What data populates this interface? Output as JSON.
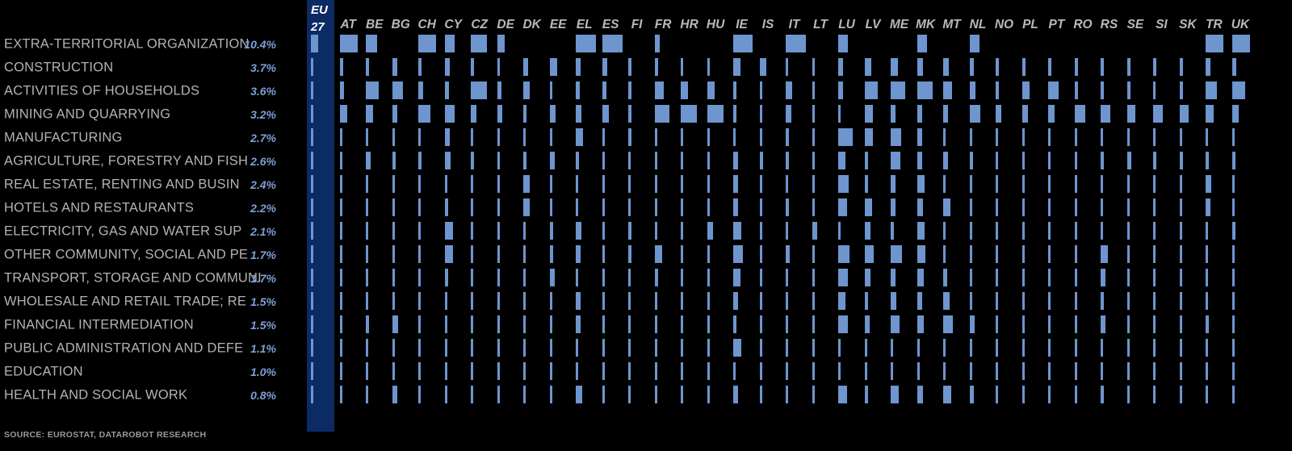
{
  "meta": {
    "eu_header_line1": "EU",
    "eu_header_line2": "27",
    "source": "SOURCE: EUROSTAT, DATAROBOT RESEARCH",
    "bar_color": "#6e95ce",
    "panel_color": "#0c2a63",
    "background_color": "#000000",
    "label_color": "#b3b3b3",
    "value_color": "#7e9fd4"
  },
  "chart_data": {
    "type": "heatmap",
    "title": "",
    "subtitle": "",
    "xlabel": "",
    "ylabel": "",
    "grid": false,
    "legend": "none",
    "notes": "Bar-matrix: each cell holds a left-aligned horizontal bar whose width encodes the sector's share per country. The first column (EU 27) is highlighted on a navy panel and is labelled with the printed percentage.",
    "categories": [
      "EXTRA-TERRITORIAL ORGANIZATION",
      "CONSTRUCTION",
      "ACTIVITIES OF HOUSEHOLDS",
      "MINING AND QUARRYING",
      "MANUFACTURING",
      "AGRICULTURE, FORESTRY AND FISH",
      "REAL ESTATE, RENTING AND BUSIN",
      "HOTELS AND RESTAURANTS",
      "ELECTRICITY, GAS AND WATER SUP",
      "OTHER COMMUNITY, SOCIAL AND PE",
      "TRANSPORT, STORAGE AND COMMUNI",
      "WHOLESALE AND RETAIL TRADE; RE",
      "FINANCIAL INTERMEDIATION",
      "PUBLIC ADMINISTRATION AND DEFE",
      "EDUCATION",
      "HEALTH AND SOCIAL WORK"
    ],
    "eu27_values": [
      "10.4%",
      "3.7%",
      "3.6%",
      "3.2%",
      "2.7%",
      "2.6%",
      "2.4%",
      "2.2%",
      "2.1%",
      "1.7%",
      "1.7%",
      "1.5%",
      "1.5%",
      "1.1%",
      "1.0%",
      "0.8%"
    ],
    "eu27_numeric": [
      10.4,
      3.7,
      3.6,
      3.2,
      2.7,
      2.6,
      2.4,
      2.2,
      2.1,
      1.7,
      1.7,
      1.5,
      1.5,
      1.1,
      1.0,
      0.8
    ],
    "countries": [
      "AT",
      "BE",
      "BG",
      "CH",
      "CY",
      "CZ",
      "DE",
      "DK",
      "EE",
      "EL",
      "ES",
      "FI",
      "FR",
      "HR",
      "HU",
      "IE",
      "IS",
      "IT",
      "LT",
      "LU",
      "LV",
      "ME",
      "MK",
      "MT",
      "NL",
      "NO",
      "PL",
      "PT",
      "RO",
      "RS",
      "SE",
      "SI",
      "SK",
      "TR",
      "UK"
    ],
    "series": [
      {
        "name": "EXTRA-TERRITORIAL ORGANIZATION",
        "values": [
          22,
          14,
          0,
          22,
          12,
          20,
          9,
          0,
          0,
          25,
          25,
          0,
          6,
          0,
          0,
          24,
          0,
          25,
          0,
          12,
          0,
          0,
          12,
          0,
          12,
          0,
          0,
          0,
          0,
          0,
          0,
          0,
          0,
          22,
          22
        ]
      },
      {
        "name": "CONSTRUCTION",
        "values": [
          4,
          4,
          6,
          4,
          6,
          4,
          3,
          6,
          9,
          6,
          6,
          4,
          4,
          3,
          3,
          9,
          8,
          3,
          3,
          6,
          8,
          9,
          7,
          7,
          5,
          4,
          4,
          4,
          4,
          4,
          4,
          4,
          4,
          6,
          5
        ]
      },
      {
        "name": "ACTIVITIES OF HOUSEHOLDS",
        "values": [
          5,
          16,
          13,
          6,
          5,
          20,
          5,
          8,
          3,
          5,
          5,
          4,
          11,
          9,
          9,
          4,
          3,
          8,
          3,
          6,
          16,
          18,
          19,
          11,
          7,
          4,
          9,
          13,
          4,
          4,
          4,
          3,
          4,
          14,
          16
        ]
      },
      {
        "name": "MINING AND QUARRYING",
        "values": [
          9,
          9,
          6,
          15,
          12,
          7,
          6,
          4,
          7,
          7,
          8,
          4,
          18,
          20,
          20,
          4,
          3,
          7,
          3,
          3,
          10,
          6,
          6,
          6,
          13,
          7,
          7,
          8,
          13,
          12,
          10,
          12,
          11,
          10,
          8
        ]
      },
      {
        "name": "MANUFACTURING",
        "values": [
          3,
          3,
          3,
          3,
          6,
          3,
          3,
          3,
          3,
          9,
          3,
          4,
          3,
          3,
          3,
          3,
          3,
          4,
          3,
          18,
          10,
          13,
          6,
          3,
          3,
          3,
          3,
          3,
          3,
          3,
          3,
          3,
          3,
          3,
          3
        ]
      },
      {
        "name": "AGRICULTURE, FORESTRY AND FISH",
        "values": [
          3,
          6,
          4,
          4,
          7,
          4,
          3,
          4,
          6,
          4,
          3,
          3,
          3,
          3,
          3,
          6,
          4,
          4,
          3,
          9,
          4,
          12,
          6,
          6,
          4,
          3,
          3,
          3,
          3,
          4,
          5,
          4,
          4,
          4,
          4
        ]
      },
      {
        "name": "REAL ESTATE, RENTING AND BUSIN",
        "values": [
          3,
          3,
          3,
          3,
          3,
          3,
          3,
          8,
          3,
          3,
          3,
          3,
          3,
          3,
          3,
          6,
          3,
          3,
          3,
          13,
          4,
          6,
          9,
          3,
          3,
          3,
          3,
          3,
          3,
          3,
          3,
          3,
          3,
          7,
          3
        ]
      },
      {
        "name": "HOTELS AND RESTAURANTS",
        "values": [
          3,
          3,
          3,
          3,
          4,
          3,
          3,
          8,
          3,
          3,
          3,
          3,
          3,
          3,
          3,
          6,
          3,
          4,
          3,
          11,
          9,
          6,
          7,
          9,
          3,
          3,
          3,
          3,
          3,
          3,
          3,
          3,
          3,
          6,
          3
        ]
      },
      {
        "name": "ELECTRICITY, GAS AND WATER SUP",
        "values": [
          3,
          3,
          3,
          3,
          10,
          3,
          3,
          3,
          4,
          7,
          3,
          4,
          3,
          3,
          7,
          10,
          3,
          3,
          6,
          3,
          7,
          4,
          9,
          3,
          3,
          3,
          3,
          3,
          3,
          3,
          3,
          3,
          3,
          3,
          4
        ]
      },
      {
        "name": "OTHER COMMUNITY, SOCIAL AND PE",
        "values": [
          3,
          3,
          3,
          3,
          10,
          3,
          3,
          3,
          4,
          6,
          3,
          4,
          9,
          3,
          3,
          12,
          3,
          5,
          3,
          14,
          11,
          14,
          10,
          3,
          3,
          3,
          3,
          3,
          3,
          9,
          3,
          3,
          3,
          3,
          3
        ]
      },
      {
        "name": "TRANSPORT, STORAGE AND COMMUNI",
        "values": [
          3,
          3,
          3,
          3,
          4,
          3,
          3,
          3,
          6,
          3,
          3,
          3,
          4,
          3,
          3,
          9,
          3,
          3,
          3,
          12,
          7,
          6,
          8,
          5,
          3,
          3,
          3,
          3,
          3,
          6,
          3,
          3,
          3,
          3,
          3
        ]
      },
      {
        "name": "WHOLESALE AND RETAIL TRADE; RE",
        "values": [
          3,
          3,
          3,
          3,
          3,
          3,
          3,
          3,
          3,
          6,
          3,
          3,
          3,
          3,
          3,
          6,
          3,
          3,
          3,
          9,
          4,
          7,
          6,
          8,
          3,
          3,
          3,
          3,
          3,
          4,
          3,
          3,
          3,
          3,
          3
        ]
      },
      {
        "name": "FINANCIAL INTERMEDIATION",
        "values": [
          3,
          4,
          7,
          3,
          3,
          3,
          3,
          3,
          3,
          6,
          3,
          3,
          3,
          3,
          3,
          4,
          3,
          3,
          3,
          12,
          6,
          11,
          8,
          12,
          6,
          3,
          3,
          3,
          3,
          6,
          3,
          3,
          3,
          4,
          3
        ]
      },
      {
        "name": "PUBLIC ADMINISTRATION AND DEFE",
        "values": [
          3,
          3,
          3,
          3,
          3,
          3,
          3,
          3,
          3,
          3,
          3,
          3,
          3,
          3,
          3,
          10,
          3,
          3,
          3,
          3,
          3,
          3,
          3,
          3,
          3,
          3,
          3,
          3,
          3,
          3,
          3,
          3,
          3,
          3,
          3
        ]
      },
      {
        "name": "EDUCATION",
        "values": [
          3,
          3,
          3,
          3,
          3,
          3,
          3,
          3,
          3,
          3,
          3,
          3,
          3,
          3,
          3,
          3,
          3,
          3,
          3,
          3,
          3,
          3,
          3,
          3,
          3,
          3,
          3,
          3,
          3,
          3,
          3,
          3,
          3,
          3,
          3
        ]
      },
      {
        "name": "HEALTH AND SOCIAL WORK",
        "values": [
          3,
          3,
          6,
          3,
          3,
          3,
          3,
          3,
          3,
          8,
          3,
          3,
          3,
          3,
          3,
          6,
          3,
          3,
          3,
          11,
          4,
          10,
          7,
          10,
          5,
          3,
          3,
          3,
          3,
          4,
          3,
          3,
          3,
          3,
          3
        ]
      }
    ],
    "eu27_bar_widths": [
      9,
      3,
      3,
      3,
      3,
      3,
      3,
      3,
      3,
      3,
      3,
      3,
      3,
      3,
      3,
      3
    ]
  }
}
